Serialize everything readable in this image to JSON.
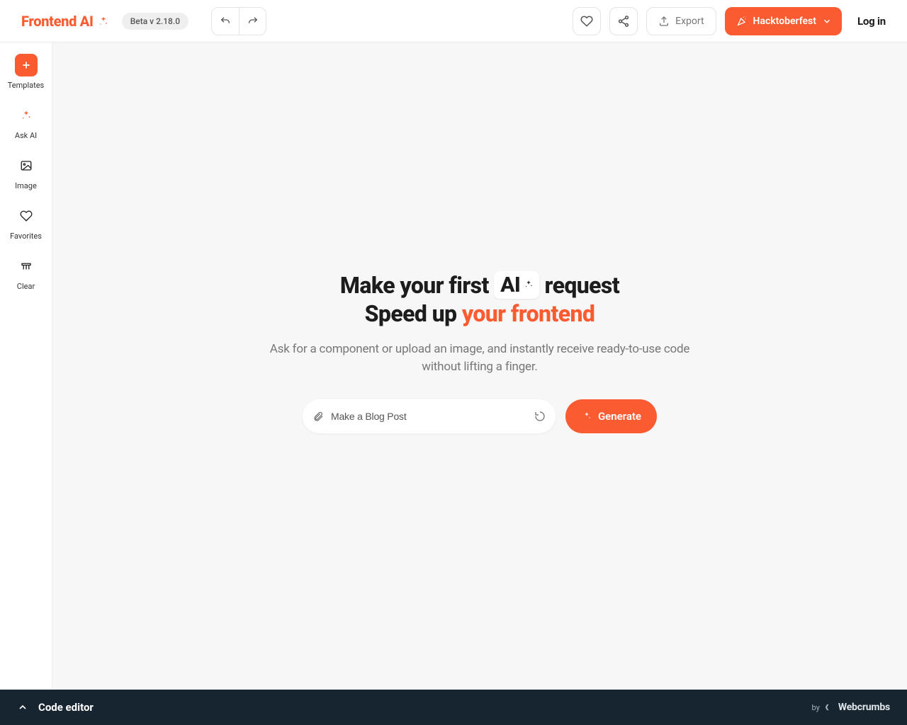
{
  "header": {
    "logo": "Frontend AI",
    "beta": "Beta v 2.18.0",
    "export": "Export",
    "hacktoberfest": "Hacktoberfest",
    "login": "Log in"
  },
  "sidebar": {
    "items": [
      {
        "label": "Templates"
      },
      {
        "label": "Ask AI"
      },
      {
        "label": "Image"
      },
      {
        "label": "Favorites"
      },
      {
        "label": "Clear"
      }
    ]
  },
  "hero": {
    "line1_pre": "Make your first ",
    "line1_chip": "AI",
    "line1_post": " request",
    "line2_pre": "Speed up ",
    "line2_hl": "your frontend",
    "sub": "Ask for a component or upload an image, and instantly receive ready-to-use code without lifting a finger.",
    "placeholder": "Make a Blog Post",
    "generate": "Generate"
  },
  "footer": {
    "code_editor": "Code editor",
    "by": "by",
    "brand": "Webcrumbs"
  }
}
